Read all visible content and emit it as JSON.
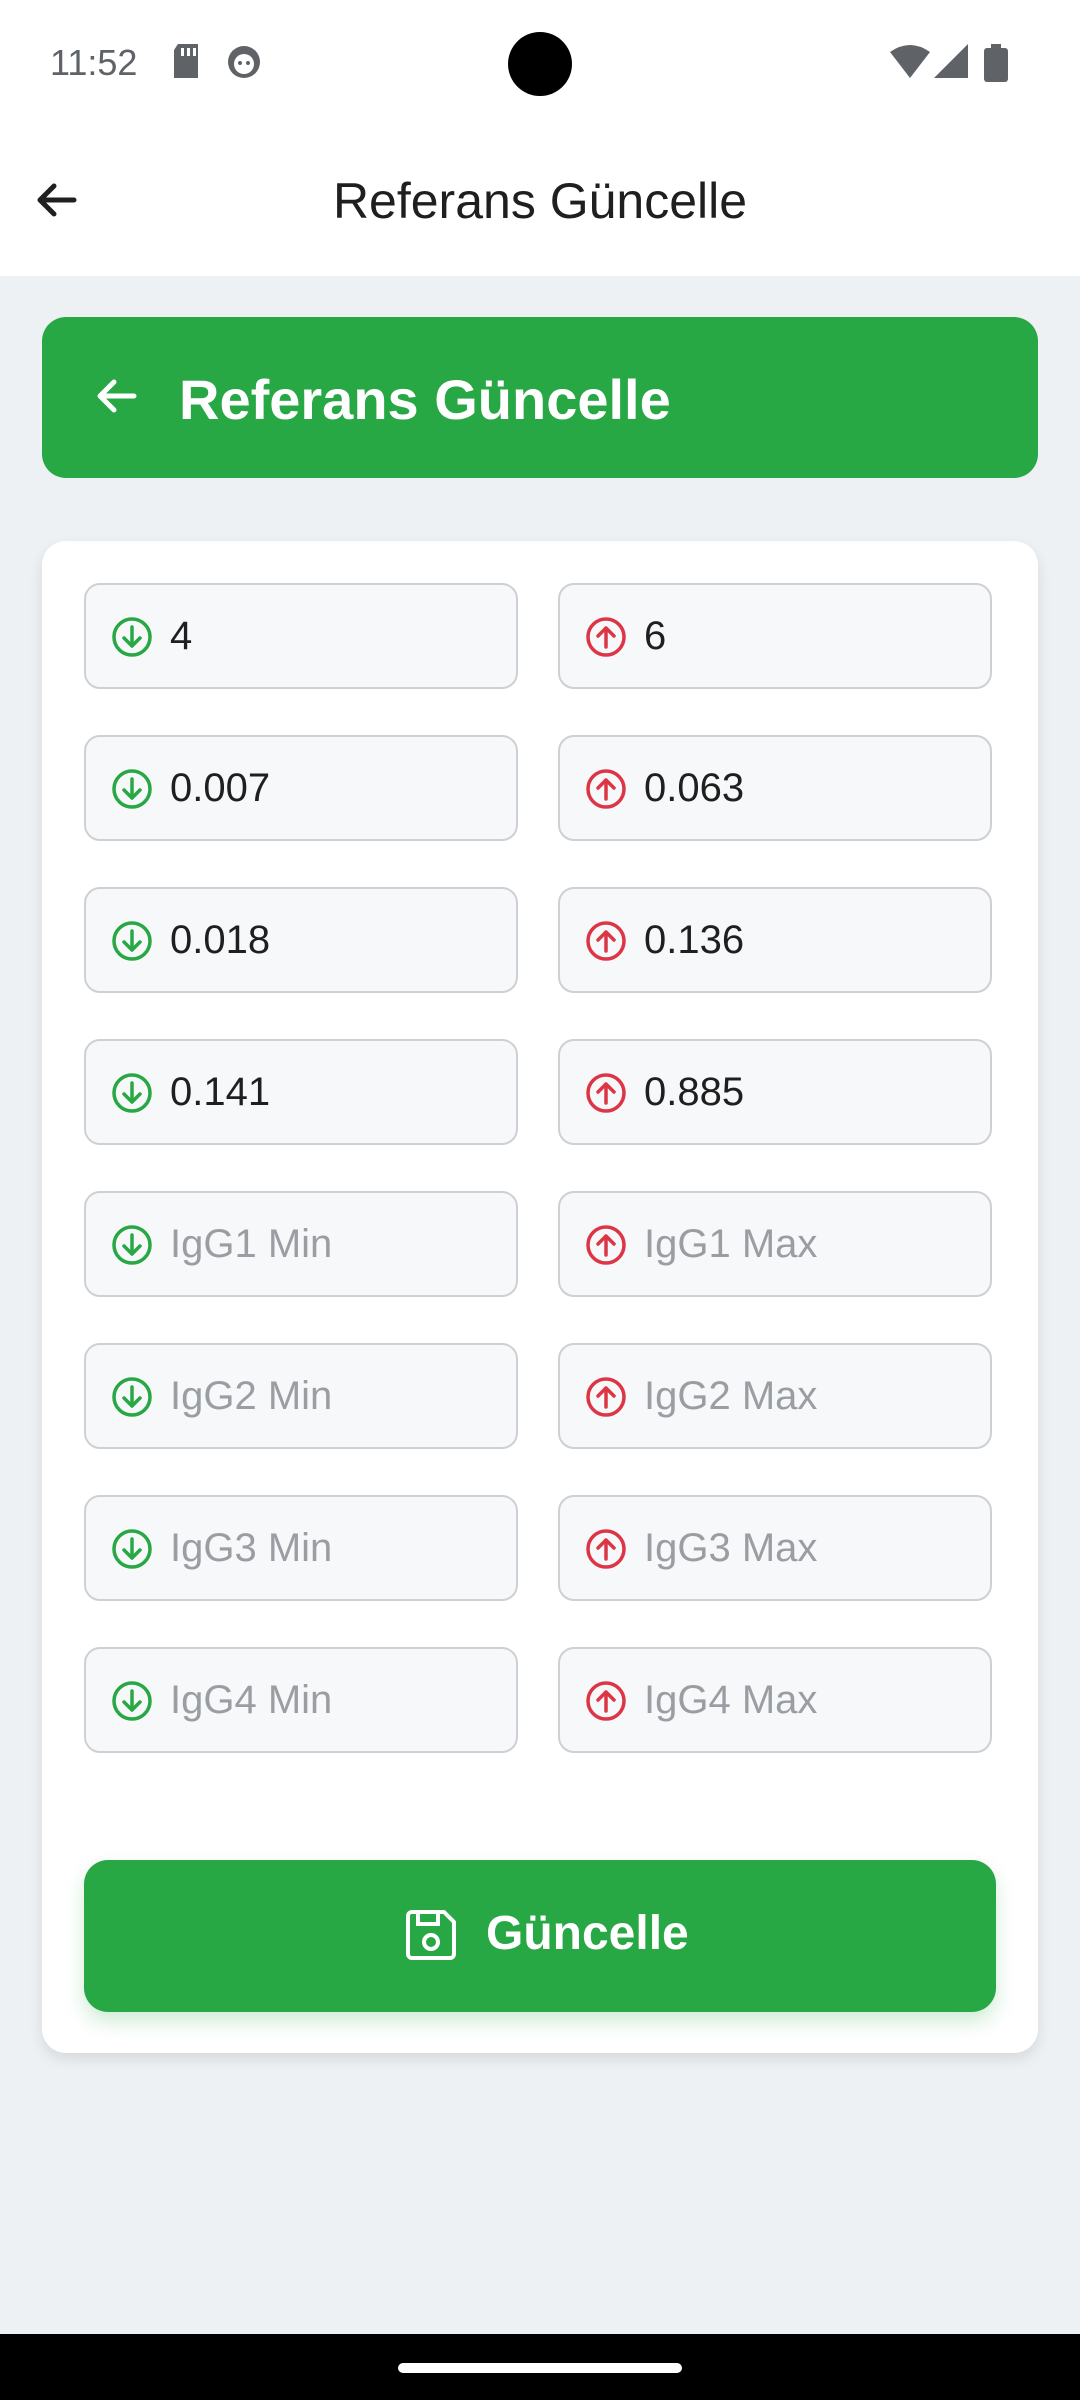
{
  "status_bar": {
    "time": "11:52"
  },
  "app_bar": {
    "title": "Referans Güncelle"
  },
  "header_card": {
    "title": "Referans Güncelle"
  },
  "colors": {
    "accent": "#28a745",
    "min_icon": "#28a745",
    "max_icon": "#dc3545"
  },
  "fields": {
    "rows": [
      {
        "min": {
          "value": "4",
          "placeholder": ""
        },
        "max": {
          "value": "6",
          "placeholder": ""
        }
      },
      {
        "min": {
          "value": "0.007",
          "placeholder": ""
        },
        "max": {
          "value": "0.063",
          "placeholder": ""
        }
      },
      {
        "min": {
          "value": "0.018",
          "placeholder": ""
        },
        "max": {
          "value": "0.136",
          "placeholder": ""
        }
      },
      {
        "min": {
          "value": "0.141",
          "placeholder": ""
        },
        "max": {
          "value": "0.885",
          "placeholder": ""
        }
      },
      {
        "min": {
          "value": "",
          "placeholder": "IgG1 Min"
        },
        "max": {
          "value": "",
          "placeholder": "IgG1 Max"
        }
      },
      {
        "min": {
          "value": "",
          "placeholder": "IgG2 Min"
        },
        "max": {
          "value": "",
          "placeholder": "IgG2 Max"
        }
      },
      {
        "min": {
          "value": "",
          "placeholder": "IgG3 Min"
        },
        "max": {
          "value": "",
          "placeholder": "IgG3 Max"
        }
      },
      {
        "min": {
          "value": "",
          "placeholder": "IgG4 Min"
        },
        "max": {
          "value": "",
          "placeholder": "IgG4 Max"
        }
      }
    ]
  },
  "update_button": {
    "label": "Güncelle",
    "icon": "save-icon"
  }
}
